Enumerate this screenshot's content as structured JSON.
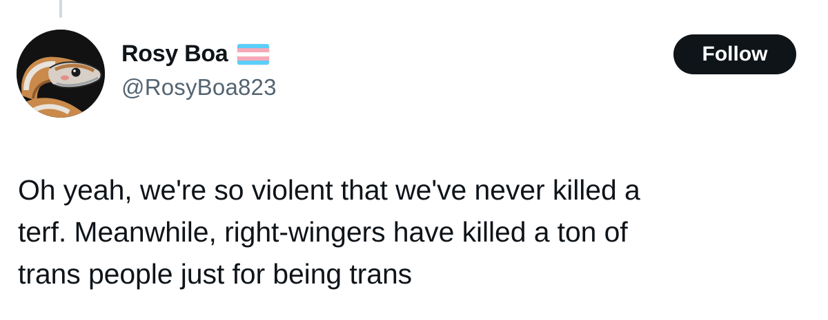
{
  "author": {
    "display_name": "Rosy Boa",
    "handle": "@RosyBoa823",
    "name_badge_icon": "transgender-flag-icon",
    "avatar_icon": "snake-avatar-icon"
  },
  "actions": {
    "follow_label": "Follow"
  },
  "tweet": {
    "lines": [
      "Oh yeah, we're so violent that we've never killed a",
      "terf. Meanwhile, right-wingers have killed a ton of",
      "trans people just for being trans"
    ]
  },
  "colors": {
    "text_primary": "#0f1419",
    "text_secondary": "#536471",
    "button_bg": "#0f1419",
    "button_text": "#ffffff",
    "flag_blue": "#5bcefa",
    "flag_pink": "#f5a9b8",
    "flag_white": "#ffffff"
  }
}
